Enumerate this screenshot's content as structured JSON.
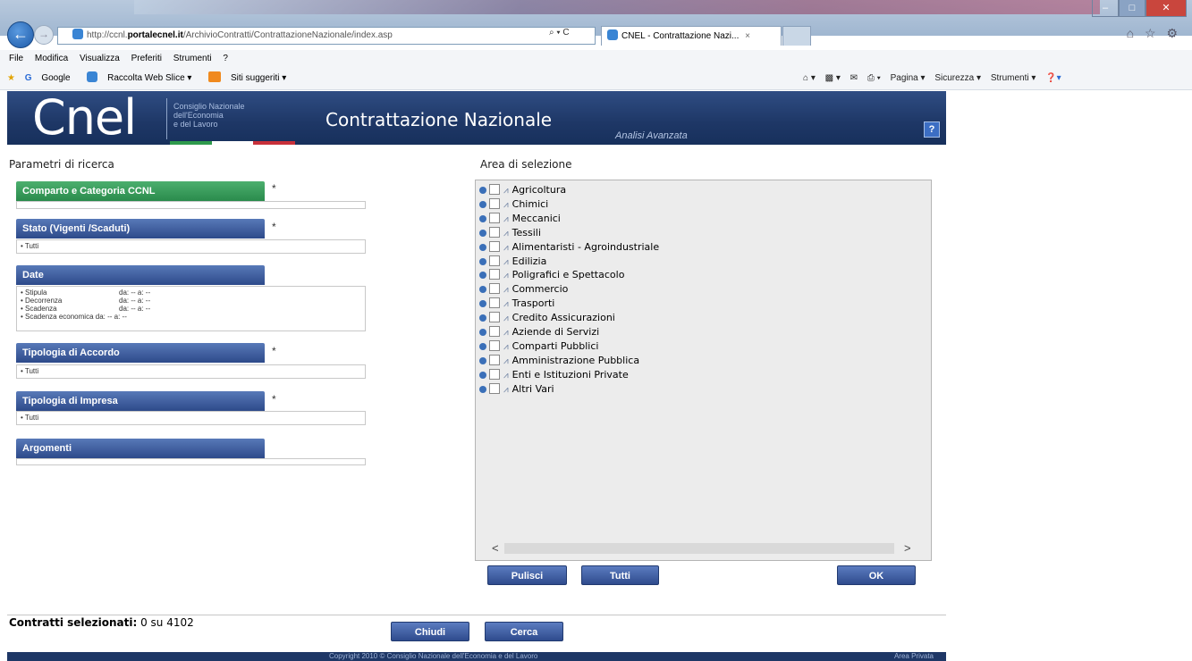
{
  "browser": {
    "url_prefix": "http://ccnl.",
    "url_domain": "portalecnel.it",
    "url_path": "/ArchivioContratti/ContrattazioneNazionale/index.asp",
    "addr_tools": "⌕ ▾ C",
    "tab_title": "CNEL - Contrattazione Nazi...",
    "tab_close": "×",
    "menu": [
      "File",
      "Modifica",
      "Visualizza",
      "Preferiti",
      "Strumenti",
      "?"
    ],
    "favorites": [
      "Google",
      "Raccolta Web Slice ▾",
      "Siti suggeriti ▾"
    ],
    "commandbar": [
      "Pagina ▾",
      "Sicurezza ▾",
      "Strumenti ▾"
    ],
    "right_icons": "⌂ ☆ ⚙"
  },
  "header": {
    "logo": "Cnel",
    "org_line1": "Consiglio Nazionale",
    "org_line2": "dell'Economia",
    "org_line3": "e del Lavoro",
    "title": "Contrattazione Nazionale",
    "subtitle": "Analisi Avanzata",
    "help": "?"
  },
  "left": {
    "title": "Parametri di ricerca",
    "req_mark": "*",
    "panels": {
      "comparto": "Comparto e Categoria CCNL",
      "stato": "Stato (Vigenti /Scaduti)",
      "stato_value": "• Tutti",
      "date": "Date",
      "dates": [
        {
          "label": "• Stipula",
          "value": "da: -- a: --"
        },
        {
          "label": "• Decorrenza",
          "value": "da: -- a: --"
        },
        {
          "label": "• Scadenza",
          "value": "da: -- a: --"
        },
        {
          "label": "• Scadenza economica",
          "value": "da: -- a: --"
        }
      ],
      "accordo": "Tipologia di Accordo",
      "accordo_value": "• Tutti",
      "impresa": "Tipologia di Impresa",
      "impresa_value": "• Tutti",
      "argomenti": "Argomenti"
    }
  },
  "right": {
    "title": "Area di selezione",
    "tree": [
      "Agricoltura",
      "Chimici",
      "Meccanici",
      "Tessili",
      "Alimentaristi - Agroindustriale",
      "Edilizia",
      "Poligrafici e Spettacolo",
      "Commercio",
      "Trasporti",
      "Credito Assicurazioni",
      "Aziende di Servizi",
      "Comparti Pubblici",
      "Amministrazione Pubblica",
      "Enti e Istituzioni Private",
      "Altri Vari"
    ],
    "scroll_left": "<",
    "scroll_right": ">",
    "btn_pulisci": "Pulisci",
    "btn_tutti": "Tutti",
    "btn_ok": "OK"
  },
  "bottom": {
    "selected_label": "Contratti selezionati:",
    "selected_value": "0 su 4102",
    "btn_chiudi": "Chiudi",
    "btn_cerca": "Cerca",
    "copyright": "Copyright 2010 © Consiglio Nazionale dell'Economia e del Lavoro",
    "area_privata": "Area Privata"
  },
  "colors": {
    "header_blue": "#1e3766",
    "green_panel": "#2a8b4c",
    "blue_panel": "#2d4a8a",
    "flag": [
      "#2e9a4c",
      "#ffffff",
      "#c8303a"
    ]
  }
}
